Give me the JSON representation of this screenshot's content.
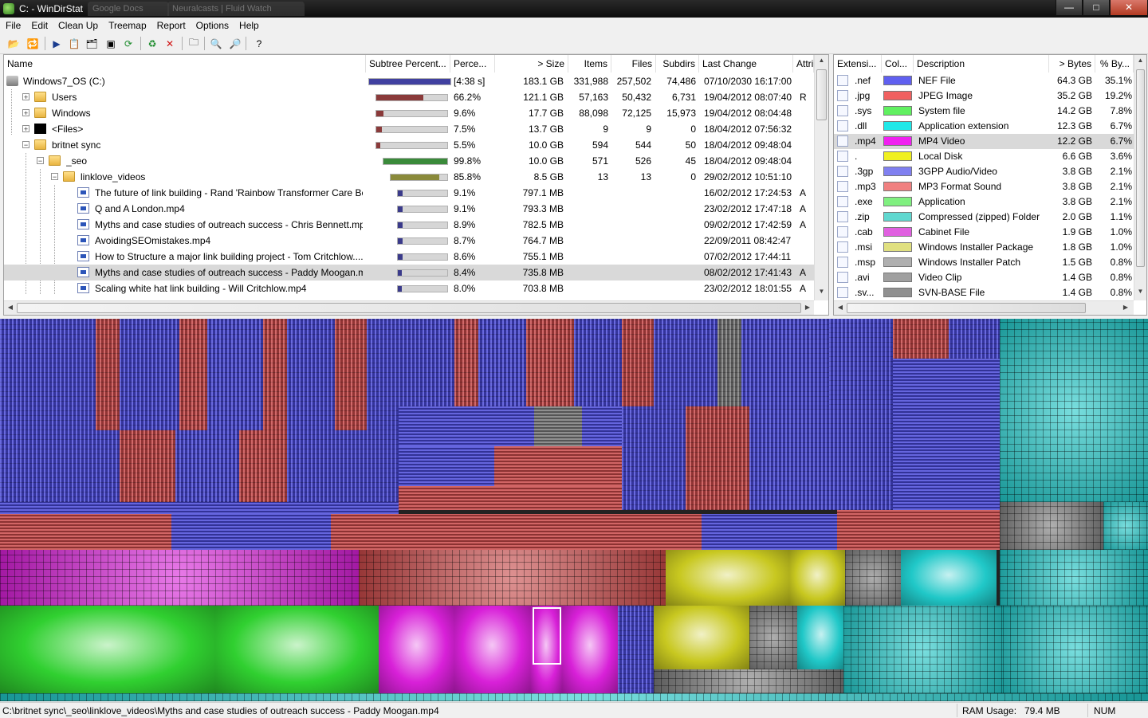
{
  "window": {
    "title": "C: - WinDirStat",
    "ghost_tabs": [
      "Google Docs",
      "Neuralcasts | Fluid Watch"
    ],
    "minimize": "—",
    "maximize": "□",
    "close": "✕"
  },
  "menu": [
    "File",
    "Edit",
    "Clean Up",
    "Treemap",
    "Report",
    "Options",
    "Help"
  ],
  "toolbar": [
    {
      "icon": "open-folder-icon",
      "glyph": "📂"
    },
    {
      "icon": "refresh-selected-icon",
      "glyph": "🔁"
    },
    {
      "icon": "play-icon",
      "glyph": "▶"
    },
    {
      "icon": "copy-path-icon",
      "glyph": "📋"
    },
    {
      "icon": "explorer-icon",
      "glyph": "🗂"
    },
    {
      "icon": "command-prompt-icon",
      "glyph": "▣"
    },
    {
      "icon": "refresh-icon",
      "glyph": "⟳"
    },
    {
      "icon": "recycle-icon",
      "glyph": "♻"
    },
    {
      "icon": "delete-icon",
      "glyph": "✕"
    },
    {
      "icon": "new-folder-icon",
      "glyph": "🗀"
    },
    {
      "icon": "zoom-in-icon",
      "glyph": "🔍"
    },
    {
      "icon": "zoom-out-icon",
      "glyph": "🔎"
    },
    {
      "icon": "help-icon",
      "glyph": "?"
    }
  ],
  "tree": {
    "columns": [
      "Name",
      "Subtree Percent...",
      "Perce...",
      "> Size",
      "Items",
      "Files",
      "Subdirs",
      "Last Change",
      "Attri"
    ],
    "rows": [
      {
        "name": "Windows7_OS (C:)",
        "level": 0,
        "icon": "drive",
        "expander": "",
        "bar": 1.0,
        "bar_color": "#4040a0",
        "perc": "[4:38 s]",
        "size": "183.1 GB",
        "items": "331,988",
        "files": "257,502",
        "subdirs": "74,486",
        "changed": "07/10/2030  16:17:00",
        "attr": "",
        "selected": false
      },
      {
        "name": "Users",
        "level": 1,
        "icon": "folder",
        "expander": "+",
        "bar": 0.662,
        "bar_color": "#8a3a3a",
        "perc": "66.2%",
        "size": "121.1 GB",
        "items": "57,163",
        "files": "50,432",
        "subdirs": "6,731",
        "changed": "19/04/2012  08:07:40",
        "attr": "R",
        "selected": false
      },
      {
        "name": "Windows",
        "level": 1,
        "icon": "folder",
        "expander": "+",
        "bar": 0.096,
        "bar_color": "#8a3a3a",
        "perc": "9.6%",
        "size": "17.7 GB",
        "items": "88,098",
        "files": "72,125",
        "subdirs": "15,973",
        "changed": "19/04/2012  08:04:48",
        "attr": "",
        "selected": false
      },
      {
        "name": "<Files>",
        "level": 1,
        "icon": "files",
        "expander": "+",
        "bar": 0.075,
        "bar_color": "#8a3a3a",
        "perc": "7.5%",
        "size": "13.7 GB",
        "items": "9",
        "files": "9",
        "subdirs": "0",
        "changed": "18/04/2012  07:56:32",
        "attr": "",
        "selected": false
      },
      {
        "name": "britnet sync",
        "level": 1,
        "icon": "folder",
        "expander": "−",
        "bar": 0.055,
        "bar_color": "#8a3a3a",
        "perc": "5.5%",
        "size": "10.0 GB",
        "items": "594",
        "files": "544",
        "subdirs": "50",
        "changed": "18/04/2012  09:48:04",
        "attr": "",
        "selected": false
      },
      {
        "name": "_seo",
        "level": 2,
        "icon": "folder",
        "expander": "−",
        "bar": 0.998,
        "bar_color": "#3a8a3a",
        "perc": "99.8%",
        "size": "10.0 GB",
        "items": "571",
        "files": "526",
        "subdirs": "45",
        "changed": "18/04/2012  09:48:04",
        "attr": "",
        "selected": false
      },
      {
        "name": "linklove_videos",
        "level": 3,
        "icon": "folder",
        "expander": "−",
        "bar": 0.858,
        "bar_color": "#8a8a3a",
        "perc": "85.8%",
        "size": "8.5 GB",
        "items": "13",
        "files": "13",
        "subdirs": "0",
        "changed": "29/02/2012  10:51:10",
        "attr": "",
        "selected": false
      },
      {
        "name": "The future of link building - Rand 'Rainbow Transformer Care Be...",
        "level": 4,
        "icon": "video",
        "expander": "",
        "bar": 0.091,
        "bar_color": "#3a3a8a",
        "perc": "9.1%",
        "size": "797.1 MB",
        "items": "",
        "files": "",
        "subdirs": "",
        "changed": "16/02/2012  17:24:53",
        "attr": "A",
        "selected": false
      },
      {
        "name": "Q and A London.mp4",
        "level": 4,
        "icon": "video",
        "expander": "",
        "bar": 0.091,
        "bar_color": "#3a3a8a",
        "perc": "9.1%",
        "size": "793.3 MB",
        "items": "",
        "files": "",
        "subdirs": "",
        "changed": "23/02/2012  17:47:18",
        "attr": "A",
        "selected": false
      },
      {
        "name": "Myths and case studies of outreach success - Chris Bennett.mp4",
        "level": 4,
        "icon": "video",
        "expander": "",
        "bar": 0.089,
        "bar_color": "#3a3a8a",
        "perc": "8.9%",
        "size": "782.5 MB",
        "items": "",
        "files": "",
        "subdirs": "",
        "changed": "09/02/2012  17:42:59",
        "attr": "A",
        "selected": false
      },
      {
        "name": "AvoidingSEOmistakes.mp4",
        "level": 4,
        "icon": "video",
        "expander": "",
        "bar": 0.087,
        "bar_color": "#3a3a8a",
        "perc": "8.7%",
        "size": "764.7 MB",
        "items": "",
        "files": "",
        "subdirs": "",
        "changed": "22/09/2011  08:42:47",
        "attr": "",
        "selected": false
      },
      {
        "name": "How to Structure a major link building project - Tom Critchlow....",
        "level": 4,
        "icon": "video",
        "expander": "",
        "bar": 0.086,
        "bar_color": "#3a3a8a",
        "perc": "8.6%",
        "size": "755.1 MB",
        "items": "",
        "files": "",
        "subdirs": "",
        "changed": "07/02/2012  17:44:11",
        "attr": "",
        "selected": false
      },
      {
        "name": "Myths and case studies of outreach success - Paddy Moogan.mp4",
        "level": 4,
        "icon": "video",
        "expander": "",
        "bar": 0.084,
        "bar_color": "#3a3a8a",
        "perc": "8.4%",
        "size": "735.8 MB",
        "items": "",
        "files": "",
        "subdirs": "",
        "changed": "08/02/2012  17:41:43",
        "attr": "A",
        "selected": true
      },
      {
        "name": "Scaling white hat link building - Will Critchlow.mp4",
        "level": 4,
        "icon": "video",
        "expander": "",
        "bar": 0.08,
        "bar_color": "#3a3a8a",
        "perc": "8.0%",
        "size": "703.8 MB",
        "items": "",
        "files": "",
        "subdirs": "",
        "changed": "23/02/2012  18:01:55",
        "attr": "A",
        "selected": false
      }
    ]
  },
  "extensions": {
    "columns": [
      "Extensi...",
      "Col...",
      "Description",
      "> Bytes",
      "% By..."
    ],
    "rows": [
      {
        "ext": ".nef",
        "color": "#6060f0",
        "desc": "NEF File",
        "bytes": "64.3 GB",
        "pct": "35.1%",
        "selected": false
      },
      {
        "ext": ".jpg",
        "color": "#f06060",
        "desc": "JPEG Image",
        "bytes": "35.2 GB",
        "pct": "19.2%",
        "selected": false
      },
      {
        "ext": ".sys",
        "color": "#60f060",
        "desc": "System file",
        "bytes": "14.2 GB",
        "pct": "7.8%",
        "selected": false
      },
      {
        "ext": ".dll",
        "color": "#20e8e8",
        "desc": "Application extension",
        "bytes": "12.3 GB",
        "pct": "6.7%",
        "selected": false
      },
      {
        "ext": ".mp4",
        "color": "#f020f0",
        "desc": "MP4 Video",
        "bytes": "12.2 GB",
        "pct": "6.7%",
        "selected": true
      },
      {
        "ext": ".",
        "color": "#f0f020",
        "desc": "Local Disk",
        "bytes": "6.6 GB",
        "pct": "3.6%",
        "selected": false
      },
      {
        "ext": ".3gp",
        "color": "#8080f0",
        "desc": "3GPP Audio/Video",
        "bytes": "3.8 GB",
        "pct": "2.1%",
        "selected": false
      },
      {
        "ext": ".mp3",
        "color": "#f08080",
        "desc": "MP3 Format Sound",
        "bytes": "3.8 GB",
        "pct": "2.1%",
        "selected": false
      },
      {
        "ext": ".exe",
        "color": "#80f080",
        "desc": "Application",
        "bytes": "3.8 GB",
        "pct": "2.1%",
        "selected": false
      },
      {
        "ext": ".zip",
        "color": "#60d8d0",
        "desc": "Compressed (zipped) Folder",
        "bytes": "2.0 GB",
        "pct": "1.1%",
        "selected": false
      },
      {
        "ext": ".cab",
        "color": "#e060e0",
        "desc": "Cabinet File",
        "bytes": "1.9 GB",
        "pct": "1.0%",
        "selected": false
      },
      {
        "ext": ".msi",
        "color": "#e0e080",
        "desc": "Windows Installer Package",
        "bytes": "1.8 GB",
        "pct": "1.0%",
        "selected": false
      },
      {
        "ext": ".msp",
        "color": "#b0b0b0",
        "desc": "Windows Installer Patch",
        "bytes": "1.5 GB",
        "pct": "0.8%",
        "selected": false
      },
      {
        "ext": ".avi",
        "color": "#a0a0a0",
        "desc": "Video Clip",
        "bytes": "1.4 GB",
        "pct": "0.8%",
        "selected": false
      },
      {
        "ext": ".sv...",
        "color": "#909090",
        "desc": "SVN-BASE File",
        "bytes": "1.4 GB",
        "pct": "0.8%",
        "selected": false
      }
    ]
  },
  "treemap_colors": {
    "blue": "#4848d8",
    "red": "#c84848",
    "magenta": "#d820d8",
    "grey": "#7a7a7a",
    "yellow": "#c8c820",
    "green": "#30d030",
    "cyan": "#20c8c8"
  },
  "status": {
    "path": "C:\\britnet sync\\_seo\\linklove_videos\\Myths and case studies of outreach success - Paddy Moogan.mp4",
    "ram_label": "RAM Usage:",
    "ram_value": "79.4 MB",
    "num": "NUM"
  }
}
